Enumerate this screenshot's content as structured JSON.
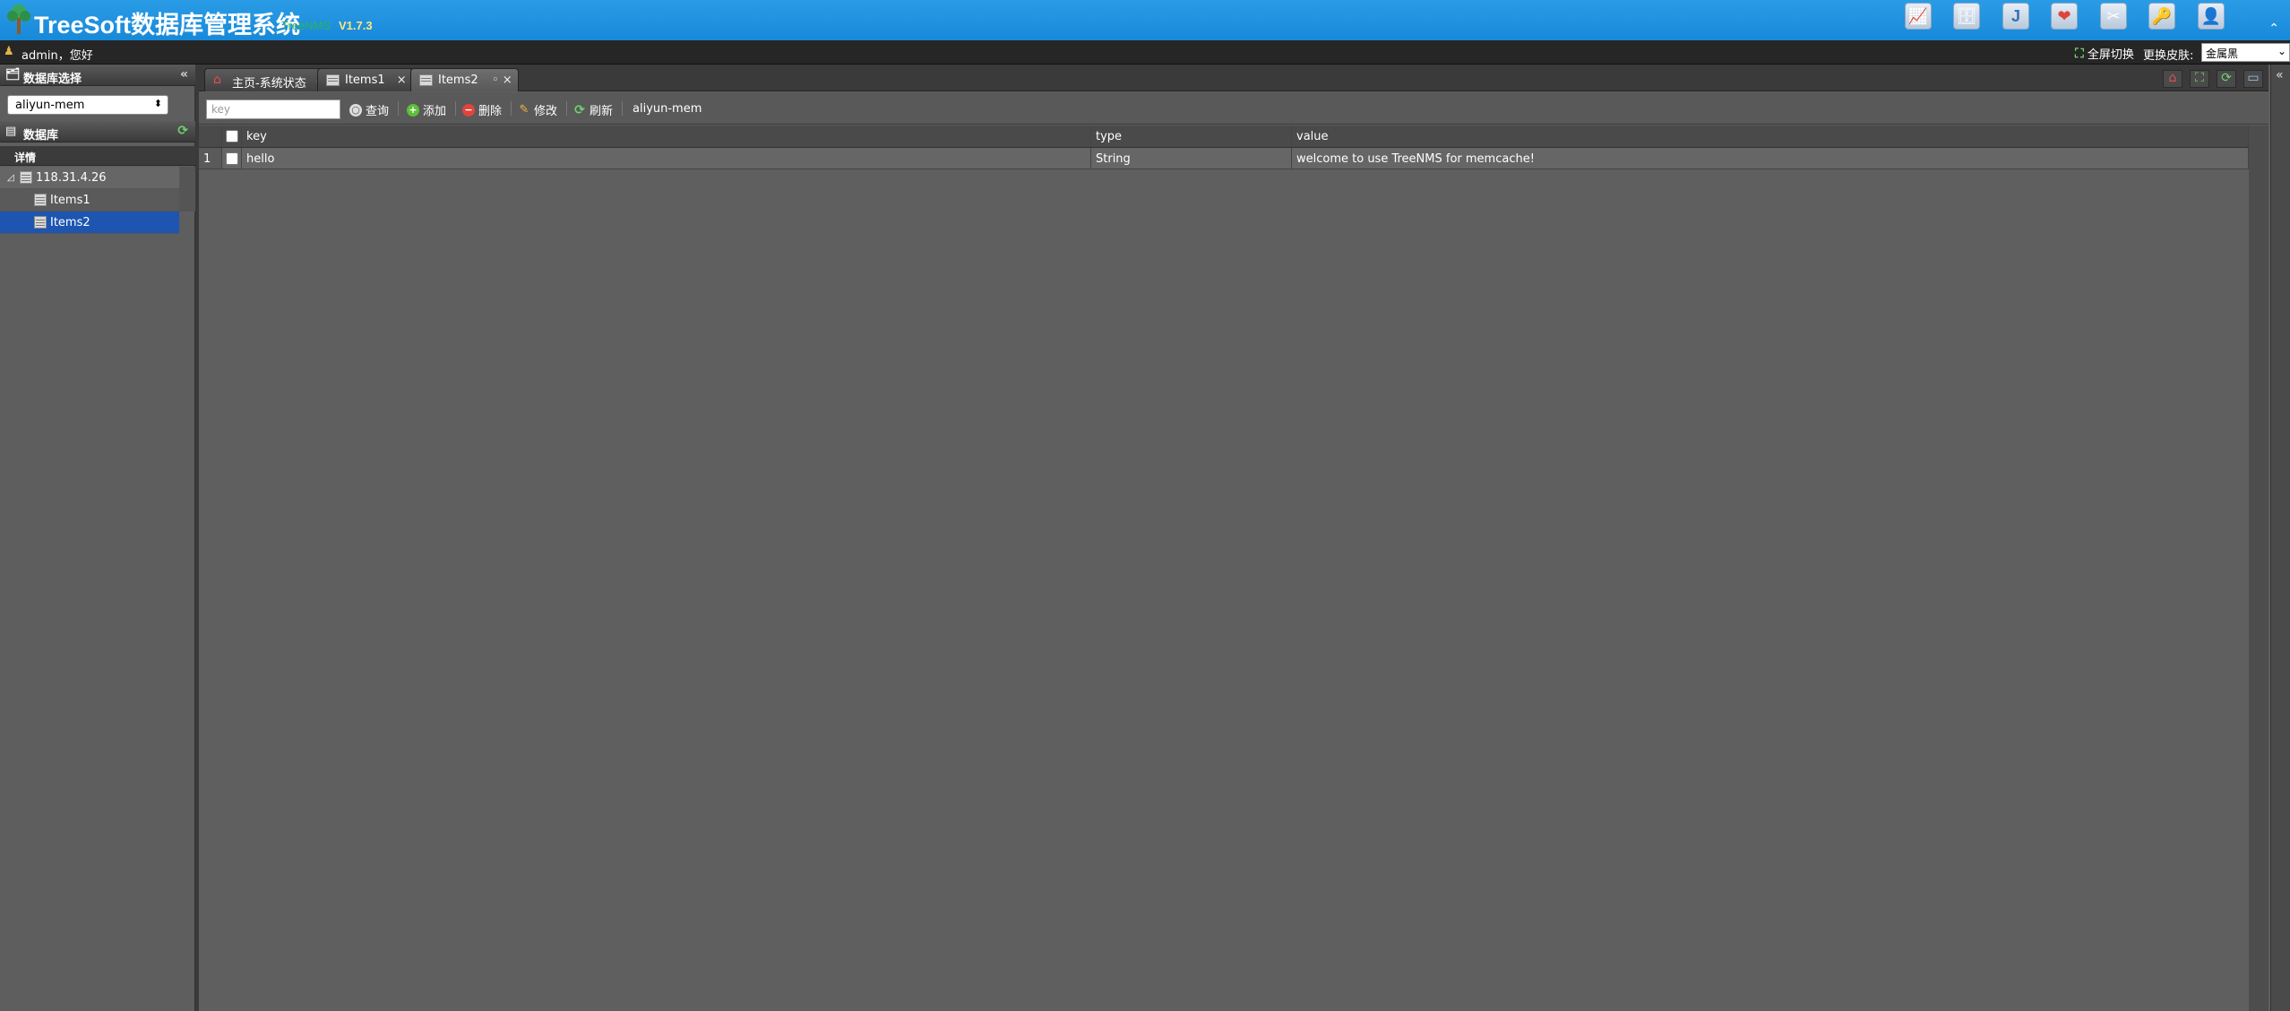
{
  "header": {
    "title": "TreeSoft数据库管理系统",
    "sub_logo": "TreeNMS",
    "version": "V1.7.3",
    "icons": [
      "chart-icon",
      "db-icon",
      "j-icon",
      "heart-icon",
      "tools-icon",
      "key-icon",
      "user-icon"
    ],
    "collapse_glyph": "⌃"
  },
  "userbar": {
    "greeting": "admin，您好",
    "fullscreen_label": "全屏切换",
    "skin_label": "更换皮肤:",
    "skin_value": "金属黑"
  },
  "left": {
    "db_select_title": "数据库选择",
    "db_select_value": "aliyun-mem",
    "db_panel_title": "数据库",
    "detail_tab": "详情",
    "tree": {
      "root": "118.31.4.26",
      "children": [
        "Items1",
        "Items2"
      ],
      "selected": "Items2"
    }
  },
  "tabs": [
    {
      "label": "主页-系统状态",
      "icon": "home-icon"
    },
    {
      "label": "Items1",
      "icon": "table-icon"
    },
    {
      "label": "Items2",
      "icon": "table-icon",
      "active": true
    }
  ],
  "toolbar": {
    "search_placeholder": "key",
    "query": "查询",
    "add": "添加",
    "delete": "删除",
    "edit": "修改",
    "refresh": "刷新",
    "connection": "aliyun-mem"
  },
  "grid": {
    "columns": [
      "key",
      "type",
      "value"
    ],
    "rows": [
      {
        "num": "1",
        "key": "hello",
        "type": "String",
        "value": "welcome to use TreeNMS for memcache!"
      }
    ]
  },
  "colors": {
    "header_blue": "#1789d9",
    "selected_blue": "#1d55b0",
    "body_gray": "#5f5f5f"
  }
}
